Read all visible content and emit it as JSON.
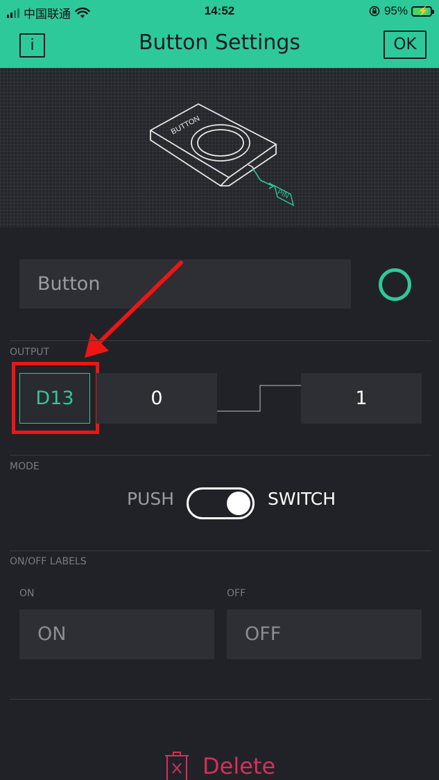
{
  "status_bar": {
    "carrier": "中国联通",
    "time": "14:52",
    "battery": "95%",
    "battery_level": 0.95,
    "icons": [
      "signal-icon",
      "wifi-icon",
      "orientation-lock-icon",
      "battery-charging-icon"
    ]
  },
  "header": {
    "info_label": "i",
    "title": "Button Settings",
    "ok_label": "OK",
    "background_color": "#2ec99a"
  },
  "illustration": {
    "device_label": "BUTTON",
    "pin_label": "PIN"
  },
  "name_field": {
    "value": "Button"
  },
  "color_picker": {
    "color": "#2ec99a"
  },
  "output": {
    "section_label": "OUTPUT",
    "pin": "D13",
    "low_value": "0",
    "high_value": "1"
  },
  "mode": {
    "section_label": "MODE",
    "push_label": "PUSH",
    "switch_label": "SWITCH",
    "selected": "SWITCH"
  },
  "on_off_labels": {
    "section_label": "ON/OFF LABELS",
    "on_caption": "ON",
    "on_value": "ON",
    "off_caption": "OFF",
    "off_value": "OFF"
  },
  "delete": {
    "label": "Delete",
    "color": "#d4305b"
  },
  "annotation": {
    "color": "#ee1515"
  }
}
